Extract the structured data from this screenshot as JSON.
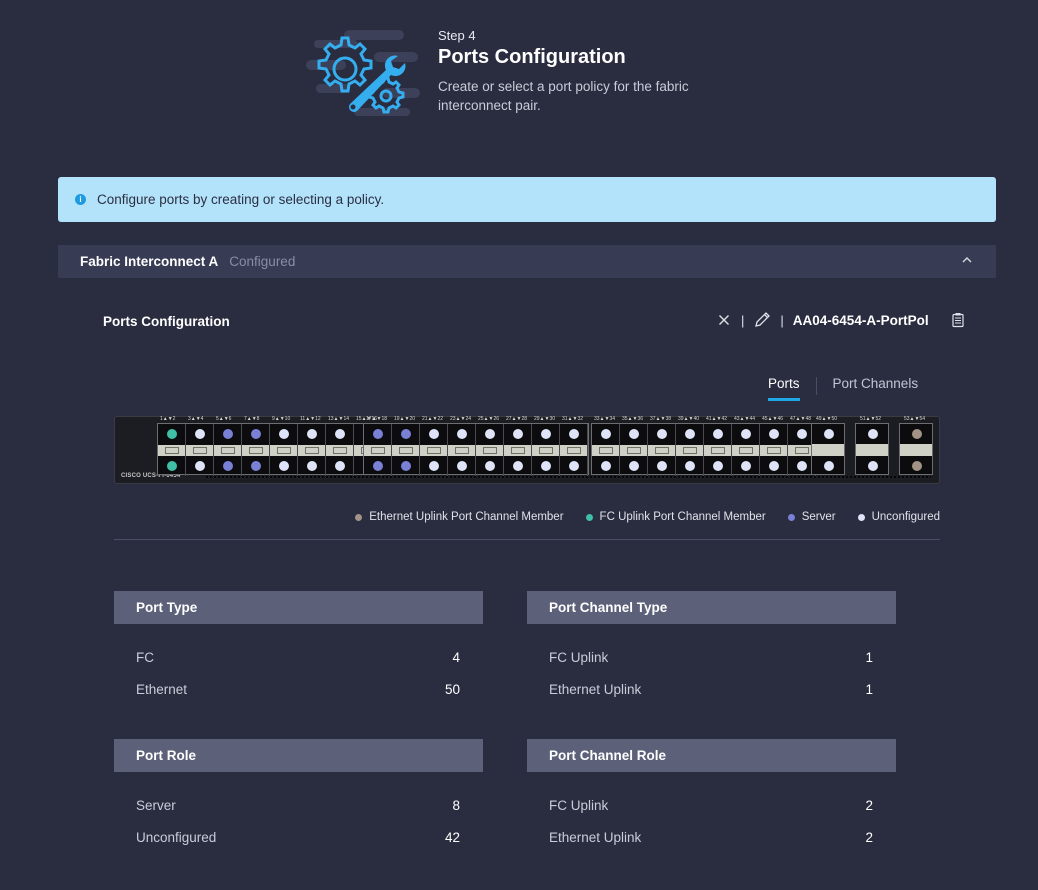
{
  "header": {
    "step": "Step 4",
    "title": "Ports Configuration",
    "description": "Create or select a port policy for the fabric interconnect pair."
  },
  "banner": {
    "icon": "info-icon",
    "text": "Configure ports by creating or selecting a policy."
  },
  "fabric": {
    "title": "Fabric Interconnect A",
    "status": "Configured",
    "expanded": true
  },
  "ports_config": {
    "title": "Ports Configuration",
    "policy_name": "AA04-6454-A-PortPol",
    "tabs": [
      {
        "label": "Ports",
        "active": true
      },
      {
        "label": "Port Channels",
        "active": false
      }
    ]
  },
  "switch": {
    "model": "CISCO UCS-FI-6454",
    "banks": [
      {
        "labels": [
          "1▲▼2",
          "3▲▼4",
          "5▲▼6",
          "7▲▼8",
          "9▲▼10",
          "11▲▼12",
          "13▲▼14",
          "15▲▼16"
        ],
        "roles": [
          "fc_pc",
          "unconf",
          "server",
          "server",
          "unconf",
          "unconf",
          "unconf",
          "unconf"
        ]
      },
      {
        "labels": [
          "17▲▼18",
          "19▲▼20",
          "21▲▼22",
          "23▲▼24",
          "25▲▼26",
          "27▲▼28",
          "29▲▼30",
          "31▲▼32"
        ],
        "roles": [
          "server",
          "server",
          "unconf",
          "unconf",
          "unconf",
          "unconf",
          "unconf",
          "unconf"
        ]
      },
      {
        "labels": [
          "33▲▼34",
          "35▲▼36",
          "37▲▼38",
          "39▲▼40",
          "41▲▼42",
          "43▲▼44",
          "45▲▼46",
          "47▲▼48"
        ],
        "roles": [
          "unconf",
          "unconf",
          "unconf",
          "unconf",
          "unconf",
          "unconf",
          "unconf",
          "unconf"
        ]
      }
    ],
    "qsfp": [
      {
        "label": "49▲▼50",
        "role": "unconf"
      },
      {
        "label": "51▲▼52",
        "role": "unconf"
      },
      {
        "label": "53▲▼54",
        "role": "eth_pc"
      }
    ]
  },
  "legend": [
    {
      "key": "eth_pc",
      "label": "Ethernet Uplink Port Channel Member",
      "color": "#a39387"
    },
    {
      "key": "fc_pc",
      "label": "FC Uplink Port Channel Member",
      "color": "#3fbfa6"
    },
    {
      "key": "server",
      "label": "Server",
      "color": "#7a80d6"
    },
    {
      "key": "unconf",
      "label": "Unconfigured",
      "color": "#dfe3f7"
    }
  ],
  "stats": {
    "port_type": {
      "title": "Port Type",
      "rows": [
        {
          "label": "FC",
          "value": "4"
        },
        {
          "label": "Ethernet",
          "value": "50"
        }
      ]
    },
    "port_channel_type": {
      "title": "Port Channel Type",
      "rows": [
        {
          "label": "FC Uplink",
          "value": "1"
        },
        {
          "label": "Ethernet Uplink",
          "value": "1"
        }
      ]
    },
    "port_role": {
      "title": "Port Role",
      "rows": [
        {
          "label": "Server",
          "value": "8"
        },
        {
          "label": "Unconfigured",
          "value": "42"
        }
      ]
    },
    "port_channel_role": {
      "title": "Port Channel Role",
      "rows": [
        {
          "label": "FC Uplink",
          "value": "2"
        },
        {
          "label": "Ethernet Uplink",
          "value": "2"
        }
      ]
    }
  },
  "colors": {
    "background": "#2a2d40",
    "accent": "#1fa7e3",
    "banner": "#b3e2fb"
  }
}
